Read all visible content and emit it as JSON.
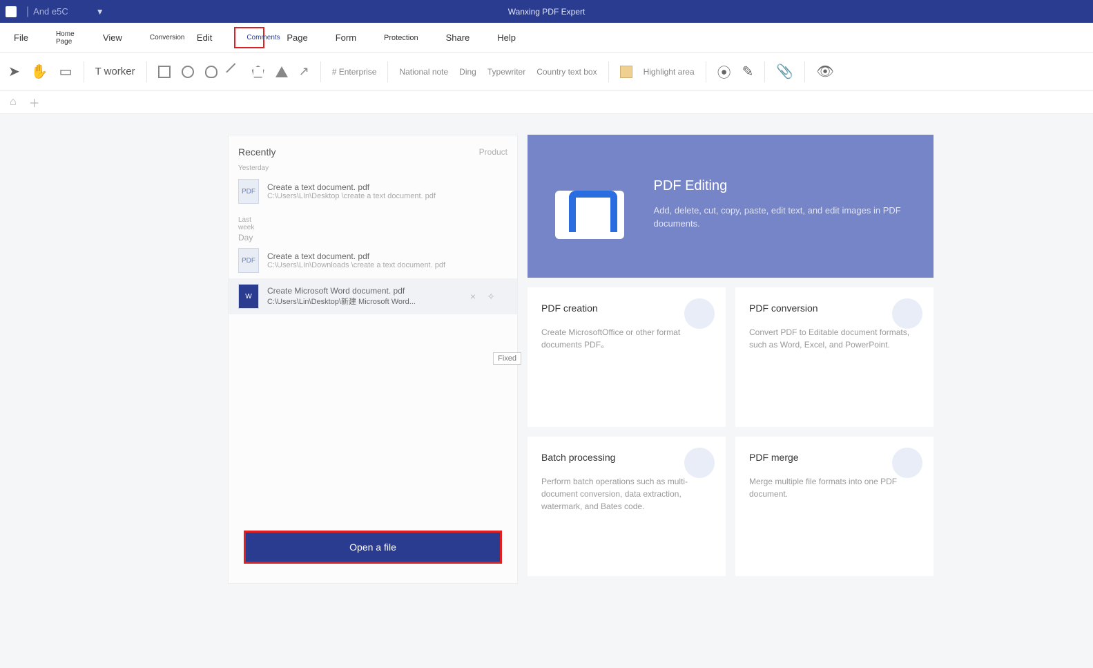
{
  "titlebar": {
    "doc_hint": "And e5C",
    "app_title": "Wanxing PDF Expert"
  },
  "menu": {
    "file": "File",
    "home": "Home Page",
    "view": "View",
    "conv": "Conversion",
    "edit": "Edit",
    "comments": "Comments",
    "page": "Page",
    "form": "Form",
    "protection": "Protection",
    "share": "Share",
    "help": "Help"
  },
  "toolbar": {
    "worker": "T  worker",
    "enterprise": "# Enterprise",
    "national_note": "National note",
    "ding": "Ding",
    "typewriter": "Typewriter",
    "textbox": "Country text box",
    "highlight_area": "Highlight area"
  },
  "left": {
    "recently": "Recently",
    "product": "Product",
    "yesterday": "Yesterday",
    "last_week": "Last week",
    "day": "Day",
    "fixed": "Fixed",
    "open_label": "Open a file",
    "files": [
      {
        "name": "Create a text document. pdf",
        "path": "C:\\Users\\LIn\\Desktop \\create a text document. pdf"
      },
      {
        "name": "Create a text document. pdf",
        "path": "C:\\Users\\LIn\\Downloads \\create a text document. pdf"
      },
      {
        "name": "Create Microsoft Word document. pdf",
        "path": "C:\\Users\\Lin\\Desktop\\新建 Microsoft Word..."
      }
    ]
  },
  "hero": {
    "title": "PDF Editing",
    "desc": "Add, delete, cut, copy, paste, edit text, and edit images in PDF documents."
  },
  "cards": {
    "c1_title": "PDF creation",
    "c1_desc": "Create MicrosoftOffice or other format documents PDF。",
    "c2_title": "PDF conversion",
    "c2_desc": "Convert PDF to Editable document formats, such as Word, Excel, and PowerPoint.",
    "c3_title": "Batch processing",
    "c3_desc": "Perform batch operations such as multi-document conversion, data extraction, watermark, and Bates code.",
    "c4_title": "PDF merge",
    "c4_desc": "Merge multiple file formats into one PDF document."
  }
}
